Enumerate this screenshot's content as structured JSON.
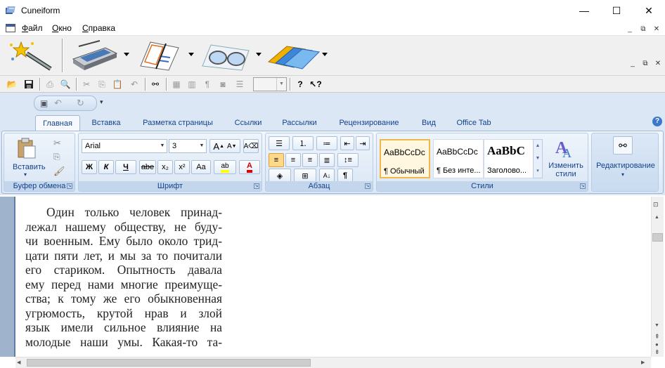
{
  "window": {
    "title": "Cuneiform",
    "minimize": "—",
    "maximize": "☐",
    "close": "✕"
  },
  "menu": {
    "items": [
      {
        "label": "Файл"
      },
      {
        "label": "Окно"
      },
      {
        "label": "Справка"
      }
    ]
  },
  "mdi": {
    "minimize": "_",
    "restore": "⧉",
    "close": "✕"
  },
  "ribbon": {
    "tabs": [
      "Главная",
      "Вставка",
      "Разметка страницы",
      "Ссылки",
      "Рассылки",
      "Рецензирование",
      "Вид",
      "Office Tab"
    ],
    "active_tab": "Главная",
    "help": "?",
    "clipboard": {
      "paste_label": "Вставить",
      "group_label": "Буфер обмена"
    },
    "font": {
      "font_name": "Arial",
      "font_size": "3",
      "grow": "A",
      "shrink": "A",
      "bold": "Ж",
      "italic": "К",
      "underline": "Ч",
      "strike": "abe",
      "subscript": "x₂",
      "superscript": "x²",
      "case": "Aa",
      "group_label": "Шрифт"
    },
    "paragraph": {
      "pilcrow": "¶",
      "group_label": "Абзац"
    },
    "styles": {
      "items": [
        {
          "preview": "AaBbCcDc",
          "name": "¶ Обычный"
        },
        {
          "preview": "AaBbCcDc",
          "name": "¶ Без инте..."
        },
        {
          "preview": "AaBbC",
          "name": "Заголово..."
        }
      ],
      "change_label": "Изменить стили",
      "group_label": "Стили"
    },
    "editing": {
      "label": "Редактирование"
    }
  },
  "document": {
    "lines": [
      "Один только человек принад-",
      "лежал нашему обществу, не буду-",
      "чи военным. Ему было около трид-",
      "цати пяти лет, и мы за то почитали",
      "его стариком. Опытность давала",
      "ему перед нами многие преимуще-",
      "ства; к тому же его обыкновенная",
      "угрюмость, крутой нрав и злой",
      "язык имели сильное влияние на",
      "молодые наши умы. Какая-то та-"
    ]
  }
}
